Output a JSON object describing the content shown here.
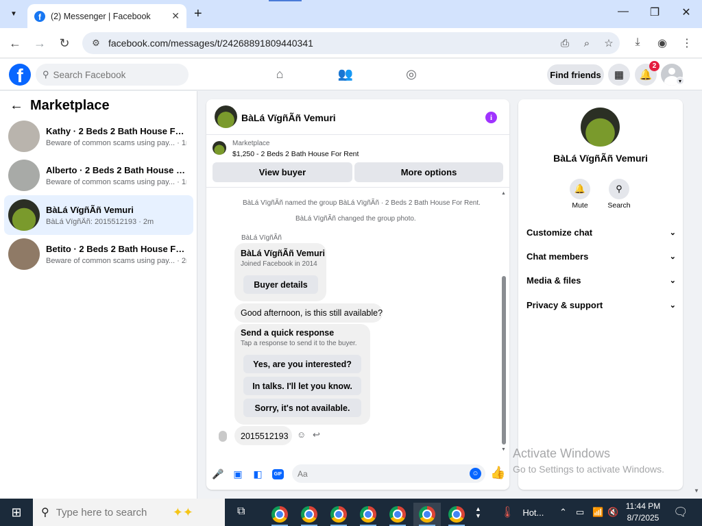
{
  "browser": {
    "tab_title": "(2) Messenger | Facebook",
    "new_tab_label": "+",
    "url": "facebook.com/messages/t/24268891809440341"
  },
  "fb": {
    "search_placeholder": "Search Facebook",
    "find_friends_label": "Find friends",
    "notification_count": "2"
  },
  "sidebar": {
    "title": "Marketplace",
    "conversations": [
      {
        "name": "Kathy · 2 Beds 2 Bath House For R...",
        "preview": "Beware of common scams using pay...",
        "time": "· 1m",
        "thumb_color": "#b9b4ad"
      },
      {
        "name": "Alberto · 2 Beds 2 Bath House For ...",
        "preview": "Beware of common scams using pay...",
        "time": "· 1m",
        "thumb_color": "#a8aaa7"
      },
      {
        "name": "BàLá VïgñÃñ Vemuri",
        "preview": "BàLá VïgñÃñ: 2015512193",
        "time": "· 2m",
        "thumb_color": "#5e6b2f"
      },
      {
        "name": "Betito · 2 Beds 2 Bath House For R...",
        "preview": "Beware of common scams using pay...",
        "time": "· 2m",
        "thumb_color": "#8f7a66"
      }
    ]
  },
  "chat": {
    "header_name": "BàLá VïgñÃñ Vemuri",
    "marketplace_label": "Marketplace",
    "listing": "$1,250 - 2 Beds 2 Bath House For Rent",
    "view_buyer_label": "View buyer",
    "more_options_label": "More options",
    "system_msg_1": "BàLá VïgñÃñ named the group BàLá VïgñÃñ · 2 Beds 2 Bath House For Rent.",
    "system_msg_2": "BàLá VïgñÃñ changed the group photo.",
    "sender_label": "BàLá VïgñÃñ",
    "card_name": "BàLá VïgñÃñ Vemuri",
    "card_joined": "Joined Facebook in 2014",
    "buyer_details_label": "Buyer details",
    "message_1": "Good afternoon, is this still available?",
    "quick_title": "Send a quick response",
    "quick_sub": "Tap a response to send it to the buyer.",
    "quick_responses": [
      "Yes, are you interested?",
      "In talks. I'll let you know.",
      "Sorry, it's not available."
    ],
    "message_2": "2015512193",
    "composer_placeholder": "Aa"
  },
  "info_panel": {
    "name": "BàLá VïgñÃñ Vemuri",
    "mute_label": "Mute",
    "search_label": "Search",
    "sections": [
      "Customize chat",
      "Chat members",
      "Media & files",
      "Privacy & support"
    ]
  },
  "watermark": {
    "line1": "Activate Windows",
    "line2": "Go to Settings to activate Windows."
  },
  "taskbar": {
    "search_placeholder": "Type here to search",
    "weather": "Hot...",
    "time": "11:44 PM",
    "date": "8/7/2025"
  },
  "colors": {
    "facebook_blue": "#0866ff",
    "notification_red": "#e41e3f",
    "info_purple": "#a033ff",
    "active_conversation": "#e7f1ff"
  }
}
